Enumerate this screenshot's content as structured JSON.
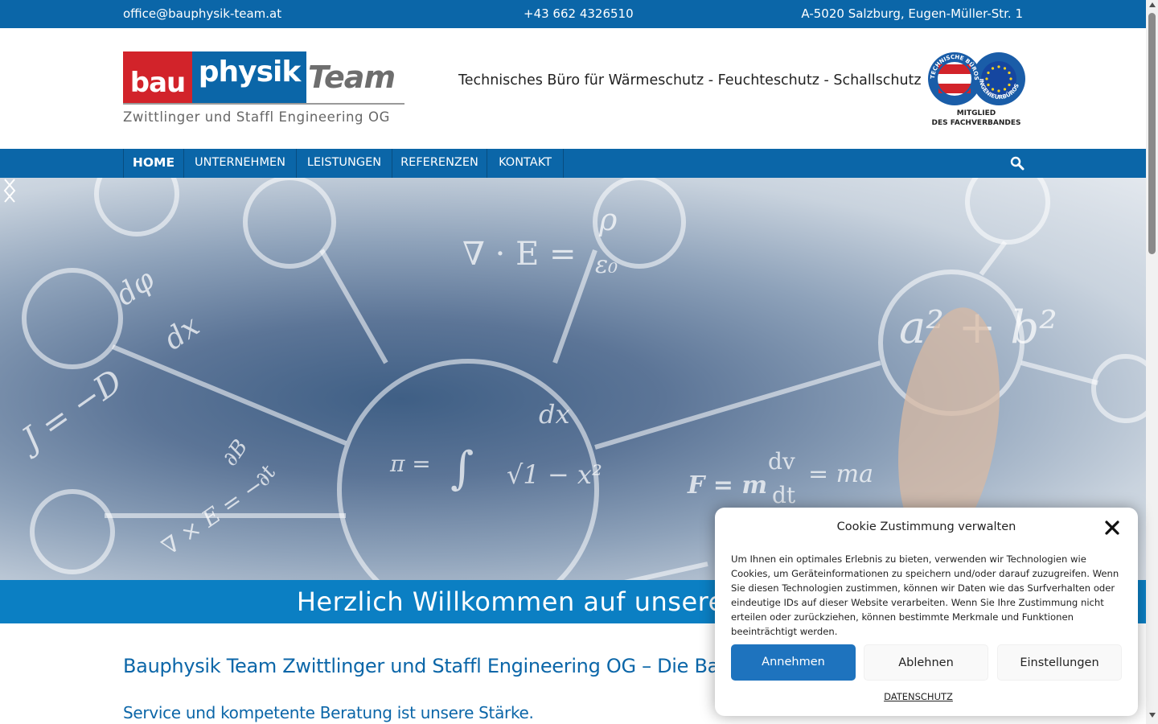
{
  "topbar": {
    "email": "office@bauphysik-team.at",
    "phone": "+43 662 4326510",
    "address": "A-5020 Salzburg, Eugen-Müller-Str. 1"
  },
  "logo": {
    "part1": "bau",
    "part2": "physik",
    "part3": "Team",
    "subtitle": "Zwittlinger und Staffl Engineering OG"
  },
  "header": {
    "tagline": "Technisches Büro für Wärmeschutz - Feuchteschutz - Schallschutz",
    "badge_ring_left": "TECHNISCHE BÜROS",
    "badge_ring_right": "INGENIEURBÜROS",
    "badge_line1": "MITGLIED",
    "badge_line2": "DES FACHVERBANDES"
  },
  "nav": {
    "items": [
      {
        "label": "HOME"
      },
      {
        "label": "UNTERNEHMEN"
      },
      {
        "label": "LEISTUNGEN"
      },
      {
        "label": "REFERENZEN"
      },
      {
        "label": "KONTAKT"
      }
    ]
  },
  "hero": {
    "formulas": [
      "∇ · E =",
      "ρ",
      "ε₀",
      "a² + b²",
      "dφ",
      "dx",
      "J = −D",
      "dx",
      "√1 − x²",
      "π =",
      "∫",
      "F = m",
      "dv",
      "dt",
      "= ma",
      "∇ × E = −",
      "∂B",
      "∂t"
    ],
    "welcome": "Herzlich Willkommen auf unserer Website"
  },
  "content": {
    "heading": "Bauphysik Team Zwittlinger und Staffl Engineering OG – Die Bauphysiker",
    "subheading": "Service und kompetente Beratung ist unsere Stärke."
  },
  "cookie": {
    "title": "Cookie Zustimmung verwalten",
    "text": "Um Ihnen ein optimales Erlebnis zu bieten, verwenden wir Technologien wie Cookies, um Geräteinformationen zu speichern und/oder darauf zuzugreifen. Wenn Sie diesen Technologien zustimmen, können wir Daten wie das Surfverhalten oder eindeutige IDs auf dieser Website verarbeiten. Wenn Sie Ihre Zustimmung nicht erteilen oder zurückziehen, können bestimmte Merkmale und Funktionen beeinträchtigt werden.",
    "accept": "Annehmen",
    "deny": "Ablehnen",
    "settings": "Einstellungen",
    "link": "DATENSCHUTZ"
  },
  "colors": {
    "primary": "#0b66a8",
    "welcome_bar": "#0b7fc3",
    "logo_red": "#d2232a",
    "accept_button": "#1e73be"
  },
  "icons": [
    "search-icon",
    "chevron-left-icon",
    "chevron-right-icon",
    "close-icon"
  ]
}
